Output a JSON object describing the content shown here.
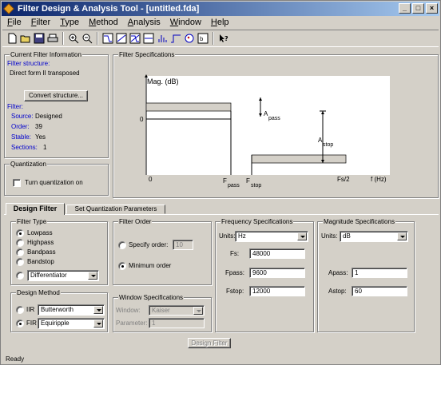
{
  "window": {
    "title": "Filter Design & Analysis Tool - [untitled.fda]"
  },
  "menu": [
    "File",
    "Filter",
    "Type",
    "Method",
    "Analysis",
    "Window",
    "Help"
  ],
  "toolbar_icons": [
    "new-icon",
    "open-icon",
    "save-icon",
    "print-icon",
    "zoom-in-icon",
    "zoom-out-icon",
    "magnitude-icon",
    "phase-icon",
    "mag-phase-icon",
    "group-delay-icon",
    "impulse-icon",
    "step-icon",
    "pole-zero-icon",
    "coefficients-icon",
    "whats-this-icon"
  ],
  "current_filter": {
    "title": "Current Filter Information",
    "structure_label": "Filter structure:",
    "structure_value": "Direct form II transposed",
    "convert_button": "Convert structure...",
    "filter_label": "Filter:",
    "source_label": "Source:",
    "source_value": "Designed",
    "order_label": "Order:",
    "order_value": "39",
    "stable_label": "Stable:",
    "stable_value": "Yes",
    "sections_label": "Sections:",
    "sections_value": "1"
  },
  "quantization": {
    "title": "Quantization",
    "checkbox_label": "Turn quantization on"
  },
  "filter_spec": {
    "title": "Filter Specifications",
    "ylabel": "Mag. (dB)",
    "zero_y1": "0",
    "zero_y2": "0",
    "x_zero": "0",
    "fpass_main": "F",
    "fpass_sub": "pass",
    "fstop_main": "F",
    "fstop_sub": "stop",
    "fs2": "Fs/2",
    "f_hz": "f (Hz)",
    "apass_main": "A",
    "apass_sub": "pass",
    "astop_main": "A",
    "astop_sub": "stop"
  },
  "tabs": {
    "design": "Design Filter",
    "quant": "Set Quantization Parameters"
  },
  "filter_type": {
    "title": "Filter Type",
    "options": [
      "Lowpass",
      "Highpass",
      "Bandpass",
      "Bandstop"
    ],
    "selected": "Lowpass",
    "other_value": "Differentiator"
  },
  "design_method": {
    "title": "Design Method",
    "iir_label": "IIR",
    "iir_value": "Butterworth",
    "fir_label": "FIR",
    "fir_value": "Equiripple"
  },
  "filter_order": {
    "title": "Filter Order",
    "specify_label": "Specify order:",
    "specify_value": "10",
    "minimum_label": "Minimum order"
  },
  "window_spec": {
    "title": "Window Specifications",
    "window_label": "Window:",
    "window_value": "Kaiser",
    "parameter_label": "Parameter:",
    "parameter_value": "1"
  },
  "freq_spec": {
    "title": "Frequency Specifications",
    "units_label": "Units:",
    "units_value": "Hz",
    "fs_label": "Fs:",
    "fs_value": "48000",
    "fpass_label": "Fpass:",
    "fpass_value": "9600",
    "fstop_label": "Fstop:",
    "fstop_value": "12000"
  },
  "mag_spec": {
    "title": "Magnitude Specifications",
    "units_label": "Units:",
    "units_value": "dB",
    "apass_label": "Apass:",
    "apass_value": "1",
    "astop_label": "Astop:",
    "astop_value": "60"
  },
  "design_button": "Design Filter",
  "status": "Ready"
}
